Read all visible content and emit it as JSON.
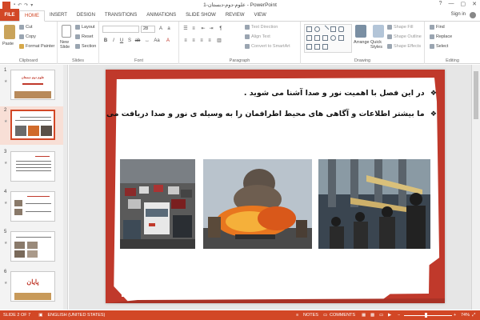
{
  "window": {
    "title": "علوم-دوم-دبستان-1 - PowerPoint",
    "controls": [
      "?",
      "—",
      "▢",
      "✕"
    ]
  },
  "tabs": {
    "file": "FILE",
    "items": [
      "HOME",
      "INSERT",
      "DESIGN",
      "TRANSITIONS",
      "ANIMATIONS",
      "SLIDE SHOW",
      "REVIEW",
      "VIEW"
    ],
    "active": "HOME",
    "signin": "Sign in"
  },
  "ribbon": {
    "clipboard": {
      "paste": "Paste",
      "cut": "Cut",
      "copy": "Copy",
      "format_painter": "Format Painter",
      "label": "Clipboard"
    },
    "slides": {
      "new_slide": "New Slide",
      "layout": "Layout",
      "reset": "Reset",
      "section": "Section",
      "label": "Slides"
    },
    "font": {
      "font_name": "",
      "font_size": "28",
      "label": "Font"
    },
    "paragraph": {
      "text_direction": "Text Direction",
      "align_text": "Align Text",
      "convert_smartart": "Convert to SmartArt",
      "label": "Paragraph"
    },
    "drawing": {
      "arrange": "Arrange",
      "quick_styles": "Quick Styles",
      "shape_fill": "Shape Fill",
      "shape_outline": "Shape Outline",
      "shape_effects": "Shape Effects",
      "label": "Drawing"
    },
    "editing": {
      "find": "Find",
      "replace": "Replace",
      "select": "Select",
      "label": "Editing"
    }
  },
  "thumbnails": [
    {
      "num": "1",
      "title": "علوم دوم دبستان"
    },
    {
      "num": "2",
      "title": ""
    },
    {
      "num": "3",
      "title": ""
    },
    {
      "num": "4",
      "title": ""
    },
    {
      "num": "5",
      "title": ""
    },
    {
      "num": "6",
      "title": "پایان"
    }
  ],
  "selected_slide": 2,
  "slide": {
    "bullet": "❖",
    "line1": "در این فصل با اهمیت نور و صدا آشنا می شوید .",
    "line2": "ما بیشتر اطلاعات و آگاهی های محیط اطرافمان را به وسیله ی نور و صدا دریافت می کنیم ."
  },
  "status": {
    "slide_info": "SLIDE 2 OF 7",
    "language": "ENGLISH (UNITED STATES)",
    "notes": "NOTES",
    "comments": "COMMENTS",
    "zoom": "74%"
  },
  "colors": {
    "accent": "#d24726",
    "slide_red": "#c0392b"
  }
}
